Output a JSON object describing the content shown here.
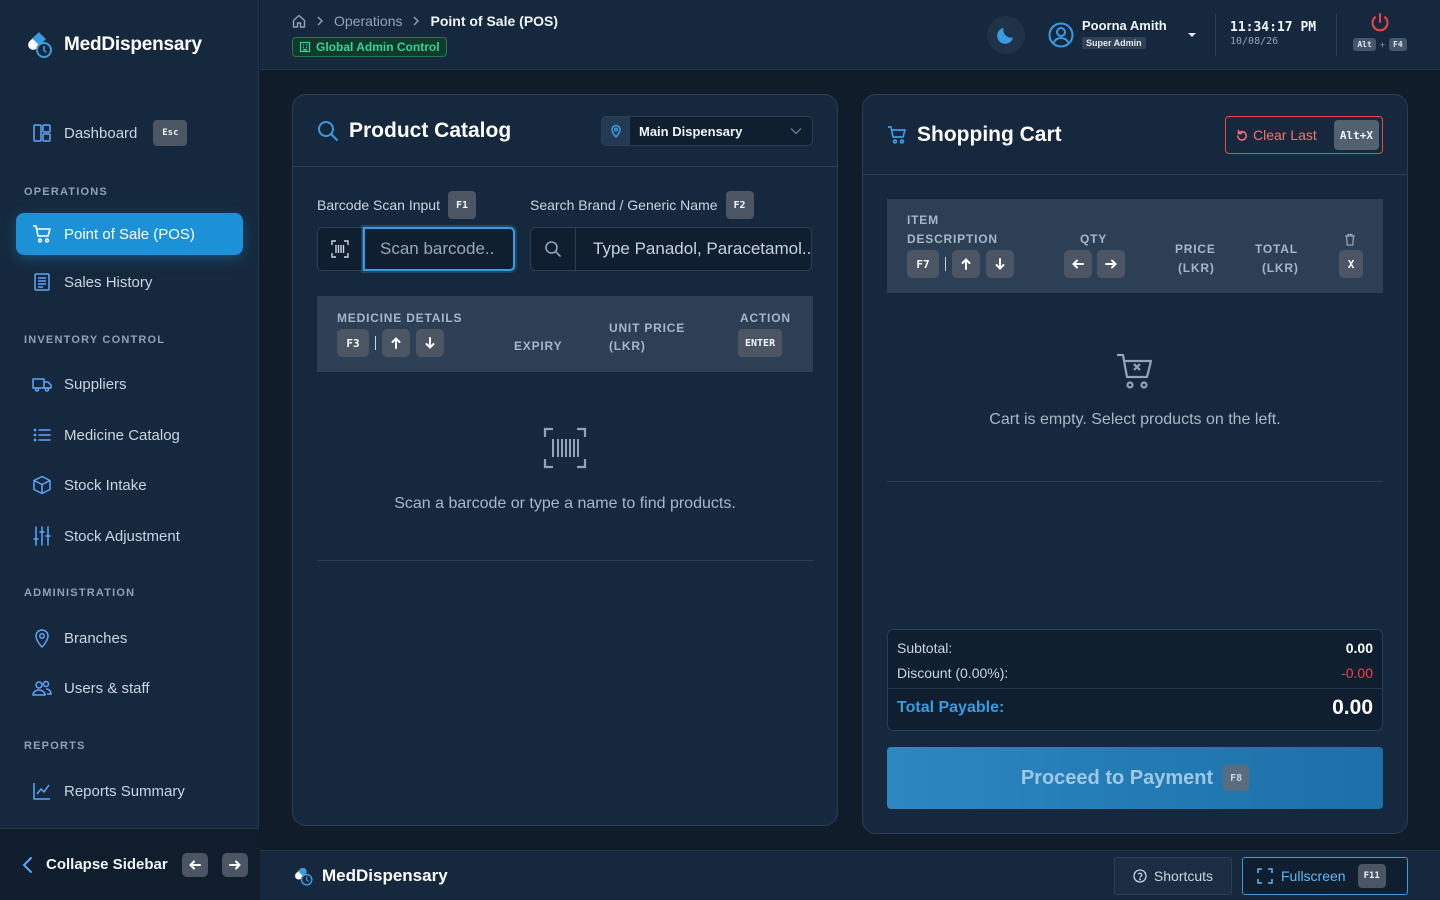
{
  "app": {
    "name": "MedDispensary"
  },
  "sidebar": {
    "dashboard": {
      "label": "Dashboard",
      "key": "Esc"
    },
    "sections": {
      "operations": "OPERATIONS",
      "inventory": "INVENTORY CONTROL",
      "administration": "ADMINISTRATION",
      "reports": "REPORTS"
    },
    "items": {
      "pos": "Point of Sale (POS)",
      "sales_history": "Sales History",
      "suppliers": "Suppliers",
      "medicine_catalog": "Medicine Catalog",
      "stock_intake": "Stock Intake",
      "stock_adjustment": "Stock Adjustment",
      "branches": "Branches",
      "users_staff": "Users & staff",
      "reports_summary": "Reports Summary"
    },
    "collapse_label": "Collapse Sidebar"
  },
  "header": {
    "breadcrumb": [
      "Operations",
      "Point of Sale (POS)"
    ],
    "admin_badge": "Global Admin Control",
    "user": {
      "name": "Poorna Amith",
      "role": "Super Admin"
    },
    "time": "11:34:17 PM",
    "date": "10/08/26",
    "logout_keys": [
      "Alt",
      "+",
      "F4"
    ]
  },
  "catalog": {
    "title": "Product Catalog",
    "branch": "Main Dispensary",
    "barcode_label": "Barcode Scan Input",
    "barcode_key": "F1",
    "barcode_placeholder": "Scan barcode..",
    "search_label": "Search Brand / Generic Name",
    "search_key": "F2",
    "search_placeholder": "Type Panadol, Paracetamol...",
    "columns": {
      "details": "MEDICINE DETAILS",
      "details_key": "F3",
      "expiry": "EXPIRY",
      "unit_price_1": "UNIT PRICE",
      "unit_price_2": "(LKR)",
      "action": "ACTION",
      "action_key": "ENTER"
    },
    "empty_message": "Scan a barcode or type a name to find products."
  },
  "cart": {
    "title": "Shopping Cart",
    "clear_label": "Clear Last",
    "clear_key": "Alt+X",
    "columns": {
      "item_1": "ITEM",
      "item_2": "DESCRIPTION",
      "item_key": "F7",
      "qty": "QTY",
      "price_1": "PRICE",
      "price_2": "(LKR)",
      "total_1": "TOTAL",
      "total_2": "(LKR)",
      "remove_key": "X"
    },
    "empty_message": "Cart is empty. Select products on the left.",
    "subtotal_label": "Subtotal:",
    "subtotal_value": "0.00",
    "discount_label": "Discount (0.00%):",
    "discount_value": "-0.00",
    "total_label": "Total Payable:",
    "total_value": "0.00",
    "pay_label": "Proceed to Payment",
    "pay_key": "F8"
  },
  "footer": {
    "brand": "MedDispensary",
    "shortcuts_label": "Shortcuts",
    "fullscreen_label": "Fullscreen",
    "fullscreen_key": "F11"
  },
  "colors": {
    "accent": "#1d91d8",
    "background": "#111c2b",
    "panel": "#15283d",
    "success": "#34d399",
    "danger": "#ef4444"
  }
}
